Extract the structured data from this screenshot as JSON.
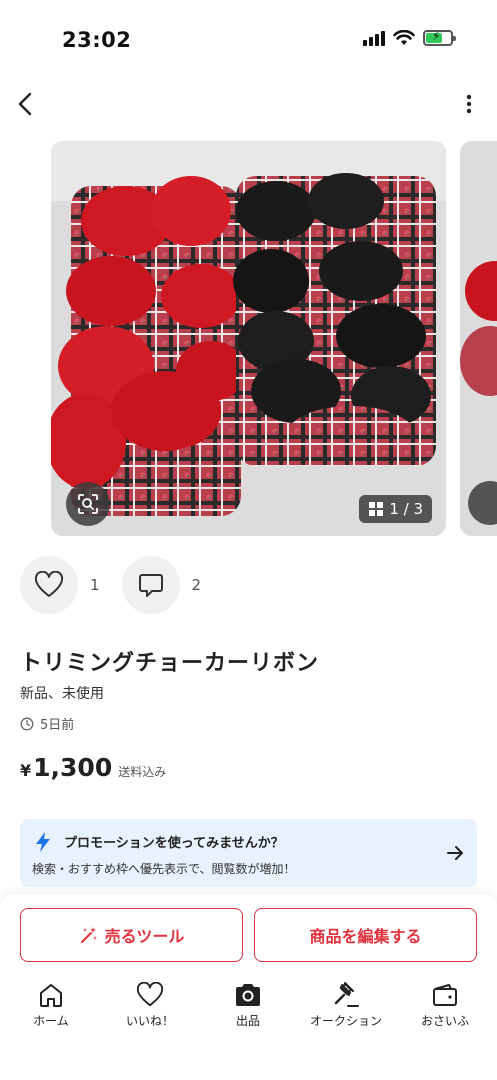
{
  "status_bar": {
    "time": "23:02"
  },
  "gallery": {
    "counter": "1 / 3"
  },
  "actions": {
    "likes_count": "1",
    "comments_count": "2"
  },
  "item": {
    "title": "トリミングチョーカーリボン",
    "condition": "新品、未使用",
    "posted": "5日前",
    "currency": "¥",
    "price": "1,300",
    "price_note": "送料込み"
  },
  "promo": {
    "title": "プロモーションを使ってみませんか？",
    "body": "検索・おすすめ枠へ優先表示で、閲覧数が増加！"
  },
  "buttons": {
    "sell_tool": "売るツール",
    "edit_item": "商品を編集する"
  },
  "tabbar": [
    {
      "label": "ホーム",
      "icon": "home-icon"
    },
    {
      "label": "いいね！",
      "icon": "heart-icon"
    },
    {
      "label": "出品",
      "icon": "camera-icon"
    },
    {
      "label": "オークション",
      "icon": "gavel-icon"
    },
    {
      "label": "おさいふ",
      "icon": "wallet-icon"
    }
  ],
  "colors": {
    "accent": "#e0323c",
    "promo_bg": "#e8f2fc",
    "promo_icon": "#1a73e8"
  }
}
